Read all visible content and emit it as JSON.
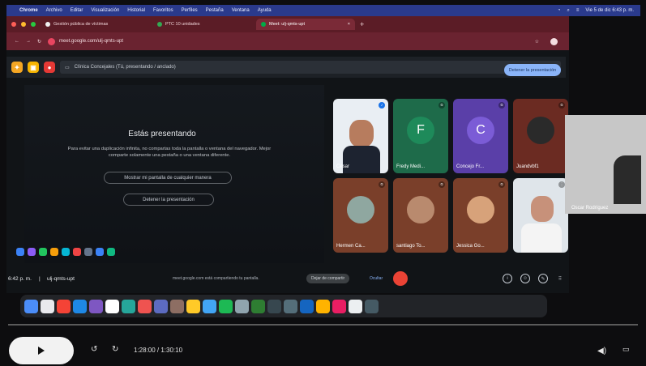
{
  "menubar": {
    "items": [
      "Chrome",
      "Archivo",
      "Editar",
      "Visualización",
      "Historial",
      "Favoritos",
      "Perfiles",
      "Pestaña",
      "Ventana",
      "Ayuda"
    ],
    "clock": "Vie 5 de dic 6:43 p. m."
  },
  "browser": {
    "tabs": [
      {
        "label": "Gestión pública de víctimas"
      },
      {
        "label": "PTC 10 unidades"
      },
      {
        "label": "Meet: ulj-qmts-upt"
      }
    ],
    "url": "meet.google.com/ulj-qmts-upt"
  },
  "share_bar": {
    "label": "Clínica Concejales (Tú, presentando / anclado)",
    "stop_button": "Detener la presentación"
  },
  "presenting": {
    "title": "Estás presentando",
    "description": "Para evitar una duplicación infinita, no compartas toda la pantalla o ventana del navegador. Mejor comparte solamente una pestaña o una ventana diferente.",
    "show_anyway": "Mostrar mi pantalla de cualquier manera",
    "stop": "Detener la presentación"
  },
  "participants": [
    {
      "name": "César",
      "kind": "photo",
      "bg": "#e9eef3"
    },
    {
      "name": "Fredy Medi...",
      "kind": "letter",
      "letter": "F",
      "bg": "#1e6b4a",
      "circle": "#1e8a5a"
    },
    {
      "name": "Concejo Fr...",
      "kind": "letter",
      "letter": "C",
      "bg": "#5a3fa8",
      "circle": "#7b5cd6"
    },
    {
      "name": "Juandvbf1",
      "kind": "avatar",
      "bg": "#6b2b22",
      "circle": "#2a2a2a"
    },
    {
      "name": "Hermen Ca...",
      "kind": "avatar",
      "bg": "#7a3f2a",
      "circle": "#8fa7a0"
    },
    {
      "name": "santiago To...",
      "kind": "avatar",
      "bg": "#7a3f2a",
      "circle": "#b98a6e"
    },
    {
      "name": "Jessica Go...",
      "kind": "avatar",
      "bg": "#7a3f2a",
      "circle": "#d7a27a"
    },
    {
      "name": "",
      "kind": "photo",
      "bg": "#dfe5ea"
    }
  ],
  "extra_participant": {
    "name": "Oscar Rodríguez"
  },
  "meet_controls": {
    "time": "6:42 p. m.",
    "separator": "|",
    "code": "ulj-qmts-upt",
    "notice": "meet.google.com está compartiendo tu pantalla.",
    "stop_sharing": "Dejar de compartir",
    "hide": "Ocultar"
  },
  "player": {
    "time": "1:28:00 / 1:30:10"
  }
}
